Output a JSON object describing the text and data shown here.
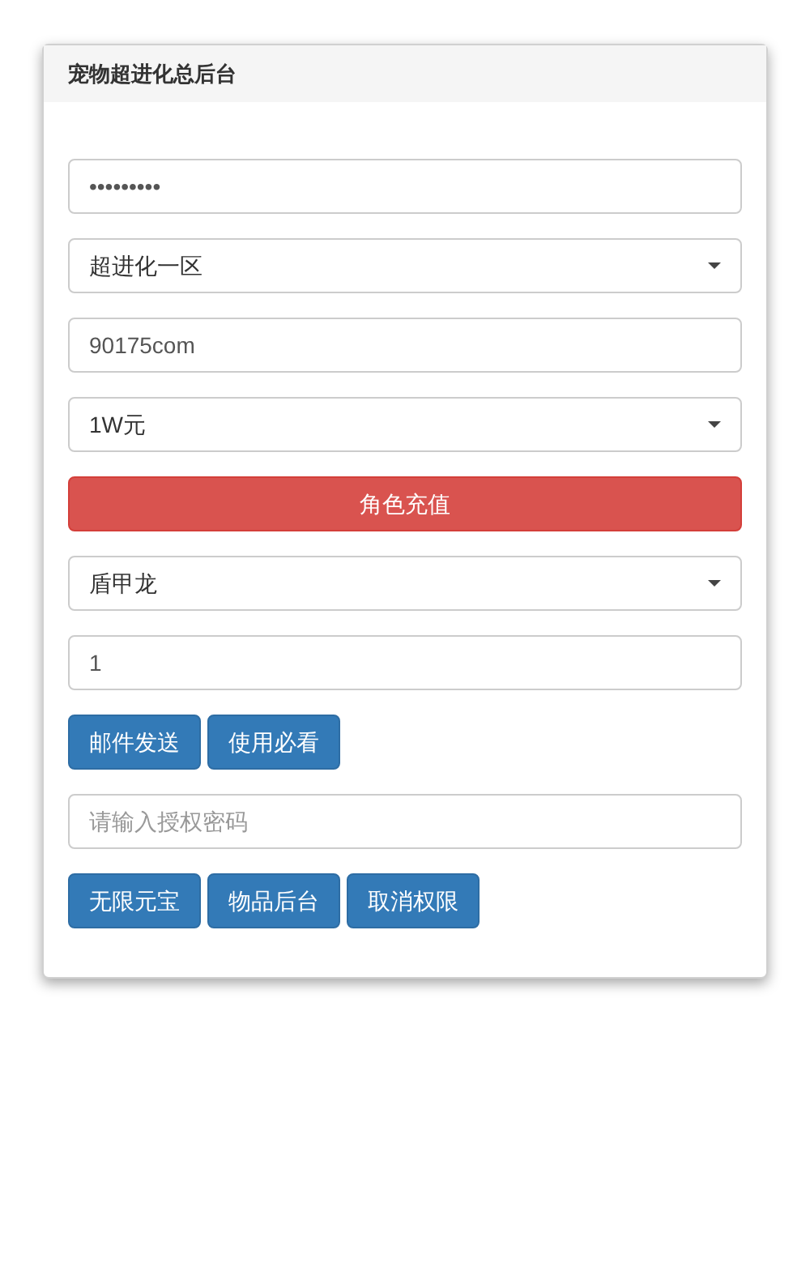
{
  "panel": {
    "title": "宠物超进化总后台"
  },
  "form": [
    {
      "kind": "field",
      "value": "•••••••••"
    },
    {
      "kind": "select",
      "value": "超进化一区"
    },
    {
      "kind": "field",
      "value": "90175com"
    },
    {
      "kind": "select",
      "value": "1W元"
    },
    {
      "kind": "danger-button",
      "label": "角色充值"
    },
    {
      "kind": "select",
      "value": "盾甲龙"
    },
    {
      "kind": "field",
      "value": "1"
    },
    {
      "kind": "buttons",
      "buttons": [
        "邮件发送",
        "使用必看"
      ]
    },
    {
      "kind": "field",
      "placeholder": "请输入授权密码"
    },
    {
      "kind": "buttons",
      "buttons": [
        "无限元宝",
        "物品后台",
        "取消权限"
      ]
    }
  ]
}
